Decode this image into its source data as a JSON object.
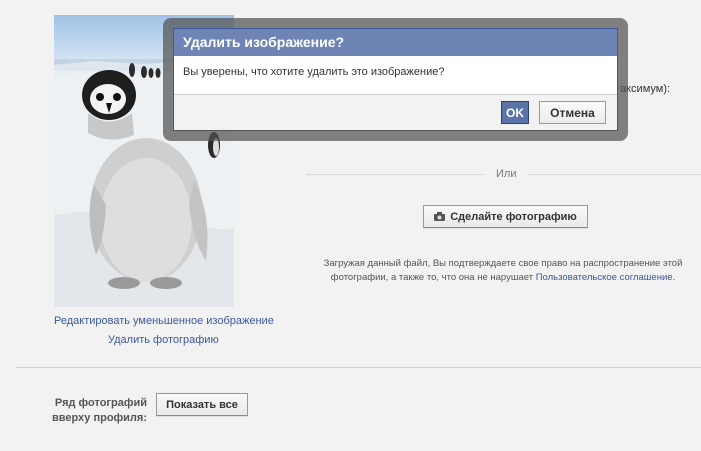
{
  "photo_panel": {
    "edit_thumbnail_link": "Редактировать уменьшенное изображение",
    "delete_photo_link": "Удалить фотографию"
  },
  "upload": {
    "partial_label": "аксимум):",
    "or_label": "Или",
    "take_photo_button": "Сделайте фотографию",
    "disclaimer_line1": "Загружая данный файл, Вы подтверждаете свое право на распространение этой",
    "disclaimer_line2_prefix": "фотографии, а также то, что она не нарушает ",
    "terms_link": "Пользовательское соглашение",
    "disclaimer_line2_suffix": "."
  },
  "photo_row": {
    "label_line1": "Ряд фотографий",
    "label_line2": "вверху профиля:",
    "show_all_button": "Показать все"
  },
  "dialog": {
    "title": "Удалить изображение?",
    "message": "Вы уверены, что хотите удалить это изображение?",
    "ok_button": "OK",
    "cancel_button": "Отмена"
  },
  "colors": {
    "dialog_header": "#6d84b4",
    "link": "#3b5998",
    "ok_button": "#5b74a8"
  }
}
